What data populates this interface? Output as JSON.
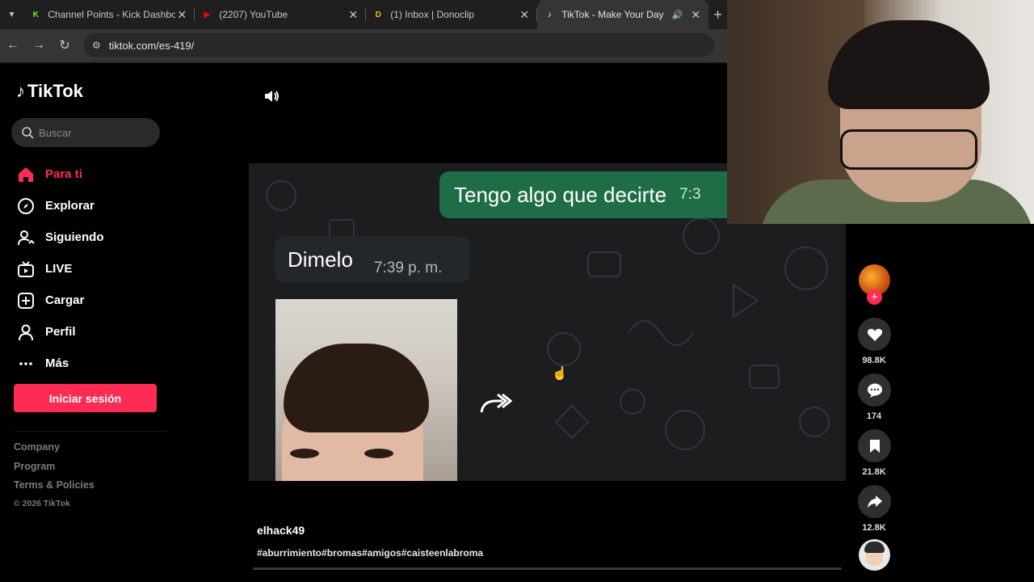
{
  "browser": {
    "tabs": [
      {
        "title": "Channel Points - Kick Dashboar",
        "favicon": "kick-icon",
        "color": "#53fc18",
        "letter": "K"
      },
      {
        "title": "(2207) YouTube",
        "favicon": "youtube-icon",
        "color": "#ff0000",
        "letter": "▶"
      },
      {
        "title": "(1) Inbox | Donoclip",
        "favicon": "donoclip-icon",
        "color": "#f5b800",
        "letter": "D"
      },
      {
        "title": "TikTok - Make Your Day",
        "favicon": "tiktok-icon",
        "color": "#ffffff",
        "letter": "♪",
        "active": true
      }
    ],
    "url": "tiktok.com/es-419/"
  },
  "sidebar": {
    "logo": "TikTok",
    "search_placeholder": "Buscar",
    "nav": [
      {
        "label": "Para ti",
        "icon": "home-icon",
        "active": true
      },
      {
        "label": "Explorar",
        "icon": "compass-icon"
      },
      {
        "label": "Siguiendo",
        "icon": "following-icon"
      },
      {
        "label": "LIVE",
        "icon": "live-icon"
      },
      {
        "label": "Cargar",
        "icon": "upload-icon"
      },
      {
        "label": "Perfil",
        "icon": "profile-icon"
      },
      {
        "label": "Más",
        "icon": "more-icon"
      }
    ],
    "login_label": "Iniciar sesión",
    "footer": [
      "Company",
      "Program",
      "Terms & Policies"
    ],
    "copyright": "© 2026 TikTok"
  },
  "video": {
    "message_out": "Tengo algo que decirte",
    "message_out_time": "7:3",
    "message_in": "Dimelo",
    "message_in_time": "7:39 p. m.",
    "progress_fraction": 0.0
  },
  "actions": {
    "likes": "98.8K",
    "comments": "174",
    "saves": "21.8K",
    "shares": "12.8K"
  },
  "post": {
    "username": "elhack49",
    "hashtags": "#aburrimiento#bromas#amigos#caisteenlabroma"
  }
}
